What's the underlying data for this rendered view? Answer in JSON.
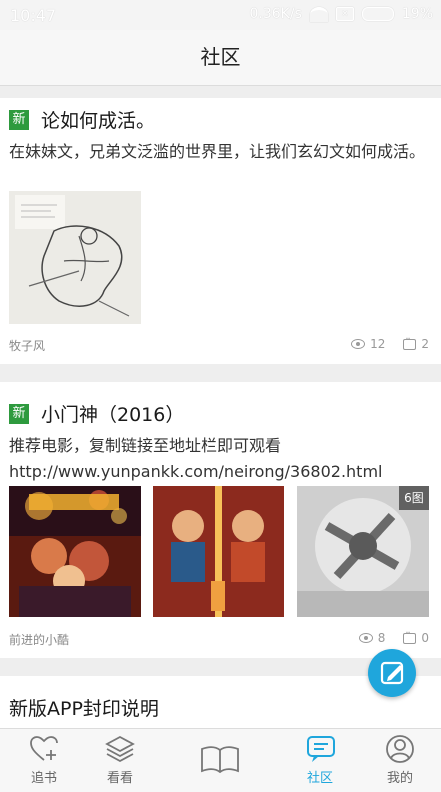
{
  "status_bar": {
    "time": "10:47",
    "network_speed": "0.36K/s",
    "battery": "19%"
  },
  "header": {
    "title": "社区"
  },
  "posts": [
    {
      "badge": "新",
      "title": "论如何成活。",
      "description": "在妹妹文，兄弟文泛滥的世界里，让我们玄幻文如何成活。",
      "author": "牧子风",
      "views": "12",
      "comments": "2"
    },
    {
      "badge": "新",
      "title": "小门神（2016）",
      "description_line1": "推荐电影，复制链接至地址栏即可观看",
      "description_line2": "http://www.yunpankk.com/neirong/36802.html",
      "image_count": "6图",
      "author": "前进的小酷",
      "views": "8",
      "comments": "0"
    },
    {
      "title": "新版APP封印说明"
    }
  ],
  "tabs": [
    {
      "label": "追书",
      "icon": "heart-plus-icon"
    },
    {
      "label": "看看",
      "icon": "layers-icon"
    },
    {
      "label": "",
      "icon": "book-icon"
    },
    {
      "label": "社区",
      "icon": "community-icon",
      "active": true
    },
    {
      "label": "我的",
      "icon": "profile-icon"
    }
  ],
  "colors": {
    "accent": "#1fa6dc",
    "new_badge": "#2e9a3e"
  }
}
